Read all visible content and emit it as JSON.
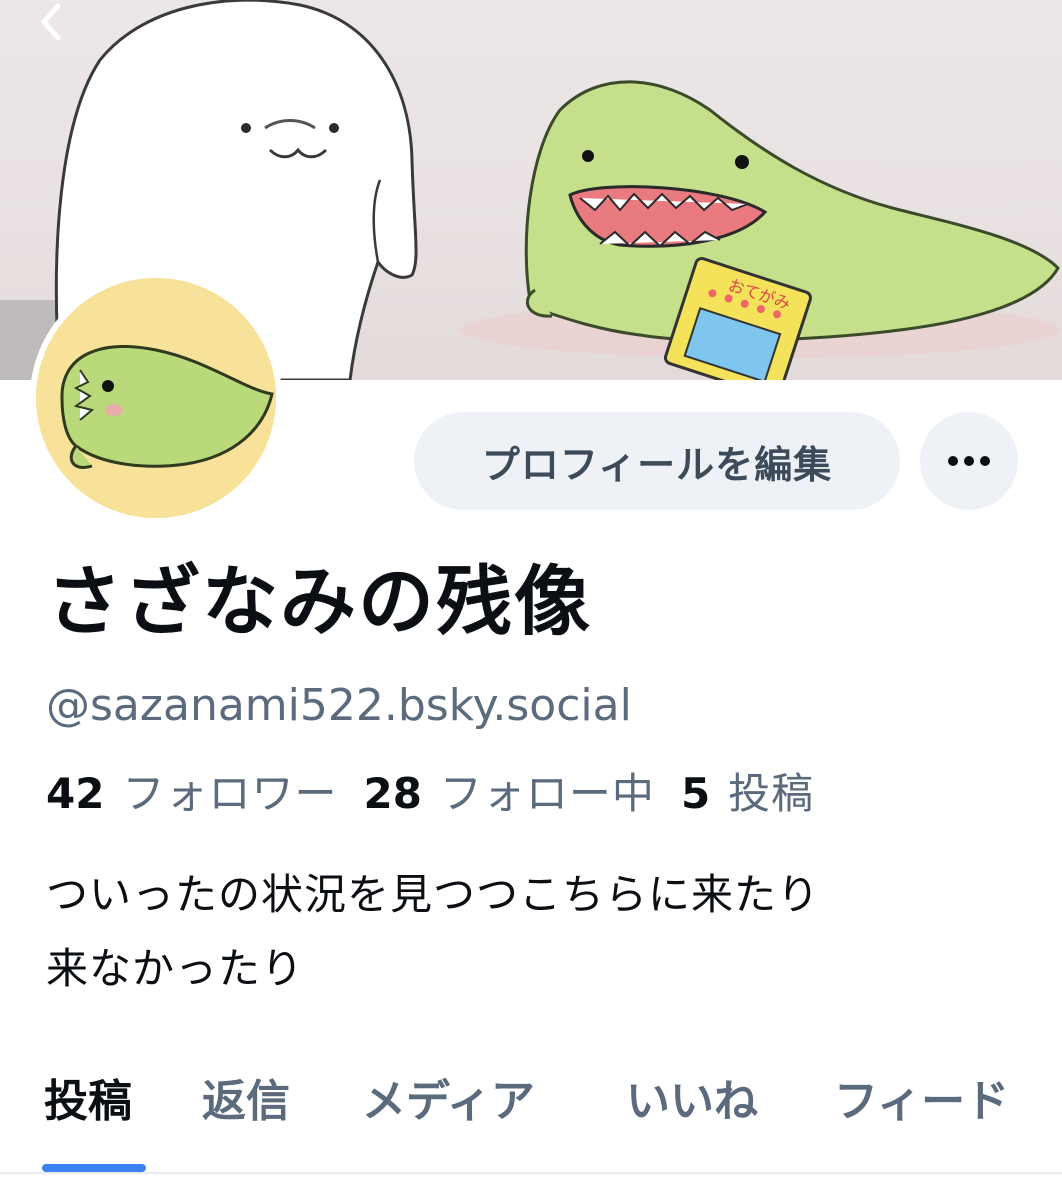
{
  "profile": {
    "display_name": "さざなみの残像",
    "handle": "@sazanami522.bsky.social",
    "edit_button_label": "プロフィールを編集",
    "stats": {
      "followers_count": "42",
      "followers_label": "フォロワー",
      "following_count": "28",
      "following_label": "フォロー中",
      "posts_count": "5",
      "posts_label": "投稿"
    },
    "bio": [
      "ついったの状況を見つつこちらに来たり",
      "来なかったり"
    ]
  },
  "tabs": [
    {
      "label": "投稿",
      "active": true
    },
    {
      "label": "返信",
      "active": false
    },
    {
      "label": "メディア",
      "active": false
    },
    {
      "label": "いいね",
      "active": false
    },
    {
      "label": "フィード",
      "active": false
    }
  ],
  "banner_text": "おてがみ",
  "icons": {
    "back": "chevron-left-icon",
    "more": "ellipsis-icon"
  },
  "colors": {
    "accent": "#3b82f6",
    "text_primary": "#0b0f14",
    "text_secondary": "#5b6a7c",
    "button_bg": "#eef2f6",
    "avatar_bg": "#f8e29a",
    "mascot_green": "#c5df8a"
  }
}
